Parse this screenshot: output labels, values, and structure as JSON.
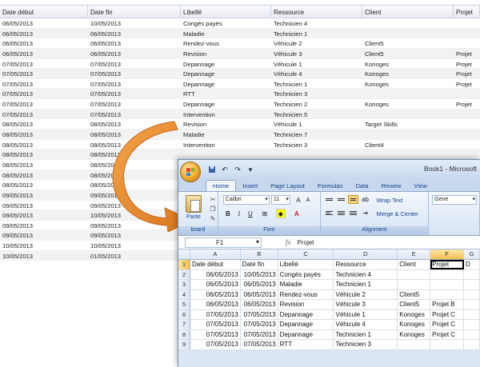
{
  "background_table": {
    "headers": [
      "Date début",
      "Date fin",
      "Libellé",
      "Ressource",
      "Client",
      "Projet"
    ],
    "rows": [
      [
        "06/05/2013",
        "10/05/2013",
        "Congés payés",
        "Technicien 4",
        "",
        ""
      ],
      [
        "06/05/2013",
        "06/05/2013",
        "Maladie",
        "Technicien 1",
        "",
        ""
      ],
      [
        "06/05/2013",
        "06/05/2013",
        "Rendez-vous",
        "Véhicule 2",
        "Client5",
        ""
      ],
      [
        "06/05/2013",
        "06/05/2013",
        "Revision",
        "Véhicule 3",
        "Client5",
        "Projet"
      ],
      [
        "07/05/2013",
        "07/05/2013",
        "Depannage",
        "Véhicule 1",
        "Konoges",
        "Projet"
      ],
      [
        "07/05/2013",
        "07/05/2013",
        "Depannage",
        "Véhicule 4",
        "Konoges",
        "Projet"
      ],
      [
        "07/05/2013",
        "07/05/2013",
        "Depannage",
        "Technicien 1",
        "Konoges",
        "Projet"
      ],
      [
        "07/05/2013",
        "07/05/2013",
        "RTT",
        "Technicien 3",
        "",
        ""
      ],
      [
        "07/05/2013",
        "07/05/2013",
        "Depannage",
        "Technicien 2",
        "Konoges",
        "Projet"
      ],
      [
        "07/05/2013",
        "07/05/2013",
        "Intervention",
        "Technicien 5",
        "",
        ""
      ],
      [
        "08/05/2013",
        "08/05/2013",
        "Revision",
        "Véhicule 1",
        "Target Skills",
        ""
      ],
      [
        "08/05/2013",
        "08/05/2013",
        "Maladie",
        "Technicien 7",
        "",
        ""
      ],
      [
        "08/05/2013",
        "08/05/2013",
        "Intervention",
        "Technicien 3",
        "Client4",
        ""
      ],
      [
        "08/05/2013",
        "08/05/2013",
        "",
        "",
        "",
        ""
      ],
      [
        "08/05/2013",
        "08/05/2013",
        "",
        "",
        "",
        ""
      ],
      [
        "08/05/2013",
        "08/05/2013",
        "",
        "",
        "",
        ""
      ],
      [
        "08/05/2013",
        "08/05/2013",
        "",
        "",
        "",
        ""
      ],
      [
        "09/05/2013",
        "09/05/2013",
        "",
        "",
        "",
        ""
      ],
      [
        "09/05/2013",
        "09/05/2013",
        "",
        "",
        "",
        ""
      ],
      [
        "09/05/2013",
        "10/05/2013",
        "",
        "",
        "",
        ""
      ],
      [
        "09/05/2013",
        "09/05/2013",
        "",
        "",
        "",
        ""
      ],
      [
        "09/05/2013",
        "09/05/2013",
        "",
        "",
        "",
        ""
      ],
      [
        "10/05/2013",
        "10/05/2013",
        "",
        "",
        "",
        ""
      ],
      [
        "10/05/2013",
        "01/05/2013",
        "",
        "",
        "",
        ""
      ]
    ]
  },
  "excel": {
    "window_title": "Book1 - Microsoft",
    "tabs": [
      "Home",
      "Insert",
      "Page Layout",
      "Formulas",
      "Data",
      "Review",
      "View"
    ],
    "ribbon": {
      "paste_label": "Paste",
      "clipboard_label": "board",
      "font_name": "Calibri",
      "font_size": "11",
      "font_label": "Font",
      "wrap_text": "Wrap Text",
      "merge_center": "Merge & Center",
      "alignment_label": "Alignment",
      "number_format": "Gene"
    },
    "name_box": "F1",
    "fx_symbol": "fx",
    "formula_content": "Projet",
    "columns": [
      "A",
      "B",
      "C",
      "D",
      "E",
      "F",
      "G"
    ],
    "rows": [
      {
        "n": "1",
        "cells": [
          "Date début",
          "Date fin",
          "Libellé",
          "Ressource",
          "Client",
          "Projet",
          "D"
        ]
      },
      {
        "n": "2",
        "cells": [
          "06/05/2013",
          "10/05/2013",
          "Congés payés",
          "Technicien 4",
          "",
          "",
          ""
        ]
      },
      {
        "n": "3",
        "cells": [
          "06/05/2013",
          "06/05/2013",
          "Maladie",
          "Technicien 1",
          "",
          "",
          ""
        ]
      },
      {
        "n": "4",
        "cells": [
          "06/05/2013",
          "06/05/2013",
          "Rendez-vous",
          "Véhicule 2",
          "Client5",
          "",
          ""
        ]
      },
      {
        "n": "5",
        "cells": [
          "06/05/2013",
          "06/05/2013",
          "Revision",
          "Véhicule 3",
          "Client5",
          "Projet B",
          ""
        ]
      },
      {
        "n": "6",
        "cells": [
          "07/05/2013",
          "07/05/2013",
          "Depannage",
          "Véhicule 1",
          "Konoges",
          "Projet C",
          ""
        ]
      },
      {
        "n": "7",
        "cells": [
          "07/05/2013",
          "07/05/2013",
          "Depannage",
          "Véhicule 4",
          "Konoges",
          "Projet C",
          ""
        ]
      },
      {
        "n": "8",
        "cells": [
          "07/05/2013",
          "07/05/2013",
          "Depannage",
          "Technicien 1",
          "Konoges",
          "Projet C",
          ""
        ]
      },
      {
        "n": "9",
        "cells": [
          "07/05/2013",
          "07/05/2013",
          "RTT",
          "Technicien 3",
          "",
          "",
          ""
        ]
      }
    ]
  },
  "colors": {
    "arrow": "#e8872b",
    "selection": "#f5c04f",
    "ribbon_text": "#15428b"
  }
}
